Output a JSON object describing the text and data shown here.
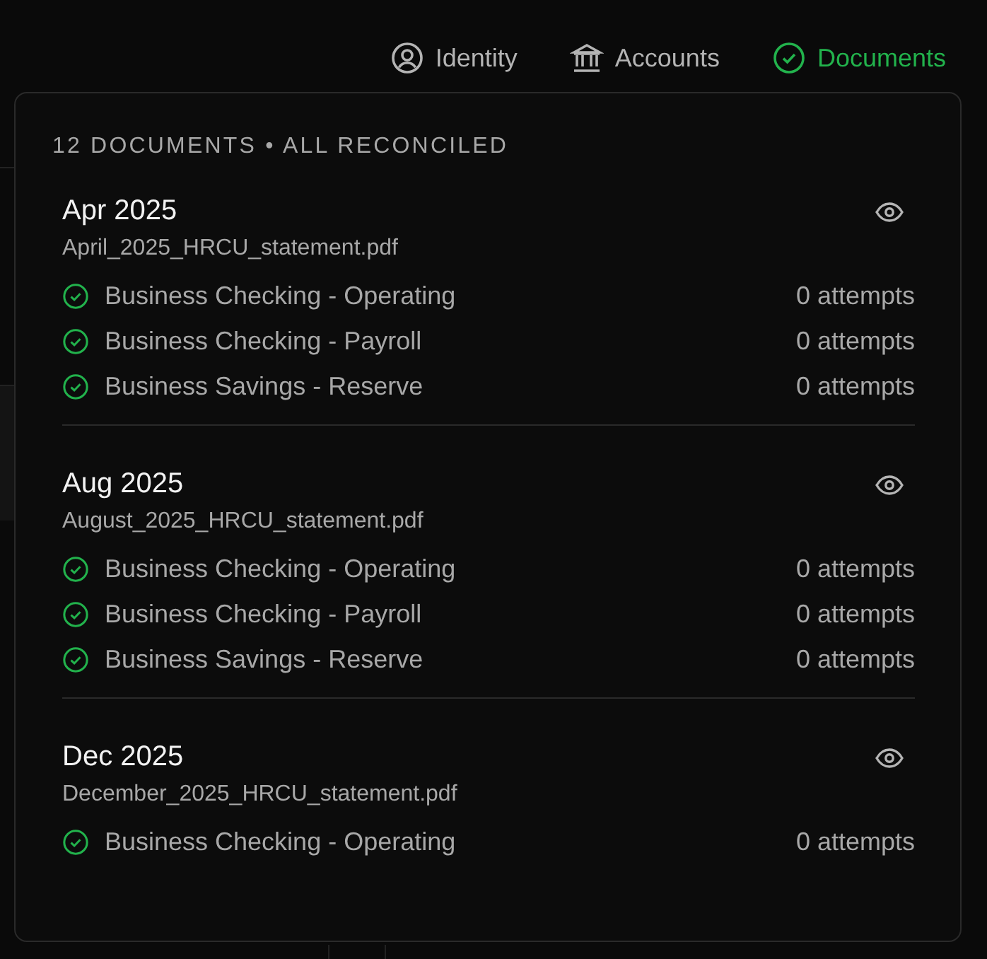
{
  "nav": [
    {
      "label": "Identity",
      "kind": "person",
      "selected": false
    },
    {
      "label": "Accounts",
      "kind": "bank",
      "selected": false
    },
    {
      "label": "Documents",
      "kind": "check",
      "selected": true
    }
  ],
  "popover": {
    "summary": "12 DOCUMENTS • ALL RECONCILED",
    "documents": [
      {
        "period": "Apr 2025",
        "filename": "April_2025_HRCU_statement.pdf",
        "accounts": [
          {
            "name": "Business Checking - Operating",
            "attempts": "0 attempts",
            "reconciled": true
          },
          {
            "name": "Business Checking - Payroll",
            "attempts": "0 attempts",
            "reconciled": true
          },
          {
            "name": "Business Savings - Reserve",
            "attempts": "0 attempts",
            "reconciled": true
          }
        ]
      },
      {
        "period": "Aug 2025",
        "filename": "August_2025_HRCU_statement.pdf",
        "accounts": [
          {
            "name": "Business Checking - Operating",
            "attempts": "0 attempts",
            "reconciled": true
          },
          {
            "name": "Business Checking - Payroll",
            "attempts": "0 attempts",
            "reconciled": true
          },
          {
            "name": "Business Savings - Reserve",
            "attempts": "0 attempts",
            "reconciled": true
          }
        ]
      },
      {
        "period": "Dec 2025",
        "filename": "December_2025_HRCU_statement.pdf",
        "accounts": [
          {
            "name": "Business Checking - Operating",
            "attempts": "0 attempts",
            "reconciled": true
          }
        ]
      }
    ]
  }
}
